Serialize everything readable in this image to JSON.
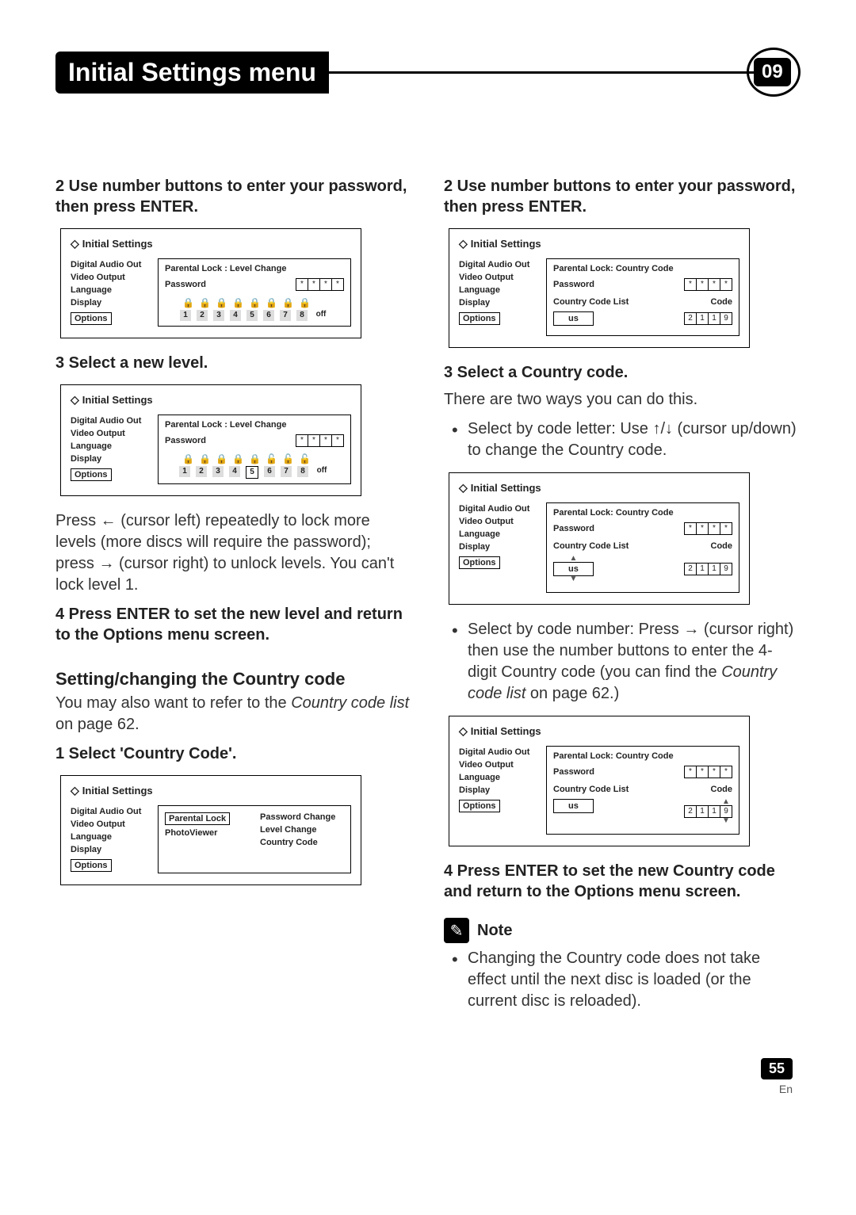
{
  "header": {
    "title": "Initial Settings menu",
    "chapter": "09"
  },
  "left": {
    "step2": "2    Use number buttons to enter your password, then press ENTER.",
    "step3": "3    Select a new level.",
    "after3": "Press ← (cursor left) repeatedly to lock more levels (more discs will require the password); press → (cursor right) to unlock levels. You can't lock level 1.",
    "step4": "4    Press ENTER to set the new level and return to the Options menu screen.",
    "sectionCC": "Setting/changing the Country code",
    "ccIntro_a": "You may also want to refer to the ",
    "ccIntro_b": "Country code list",
    "ccIntro_c": " on page 62.",
    "stepCC1": "1    Select 'Country Code'."
  },
  "right": {
    "step2": "2    Use number buttons to enter your password, then press ENTER.",
    "step3": "3    Select a Country code.",
    "step3sub": "There are two ways you can do this.",
    "bullet1": "Select by code letter: Use ↑/↓ (cursor up/down) to change the Country code.",
    "bullet2_a": "Select by code number: Press → (cursor right) then use the number buttons to enter the 4-digit Country code (you can find the ",
    "bullet2_b": "Country code list",
    "bullet2_c": " on page 62.)",
    "step4": "4    Press ENTER to set the new Country code and return to the Options menu screen.",
    "noteLabel": "Note",
    "noteText": "Changing the Country code does not take effect until the next disc is loaded (or the current disc is reloaded)."
  },
  "ui": {
    "title": "Initial Settings",
    "sidebar": [
      "Digital Audio Out",
      "Video Output",
      "Language",
      "Display",
      "Options"
    ],
    "levelChangeTitle": "Parental Lock : Level Change",
    "countryCodeTitle": "Parental Lock: Country Code",
    "password": "Password",
    "countryCodeList": "Country Code List",
    "codeLabel": "Code",
    "us": "us",
    "code": [
      "2",
      "1",
      "1",
      "9"
    ],
    "nums": [
      "1",
      "2",
      "3",
      "4",
      "5",
      "6",
      "7",
      "8"
    ],
    "off": "off",
    "optionsPanel": {
      "col1": [
        "Parental Lock",
        "PhotoViewer"
      ],
      "col2": [
        "Password Change",
        "Level Change",
        "Country Code"
      ]
    }
  },
  "footer": {
    "page": "55",
    "lang": "En"
  }
}
